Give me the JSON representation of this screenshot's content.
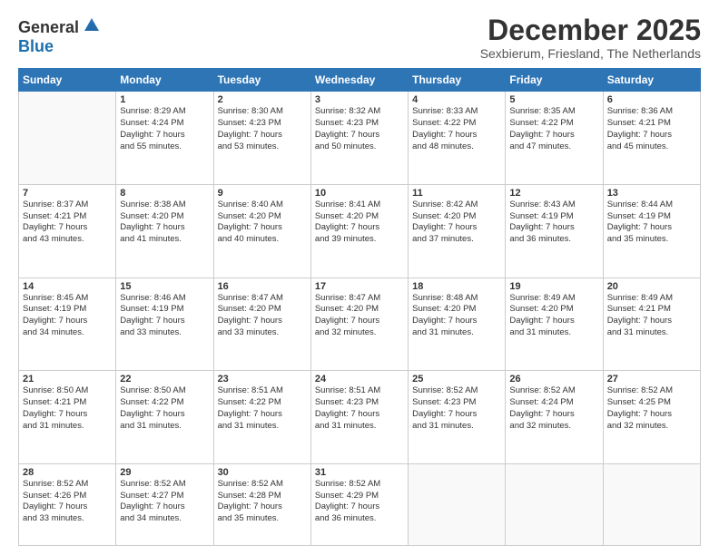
{
  "logo": {
    "general": "General",
    "blue": "Blue"
  },
  "header": {
    "month": "December 2025",
    "location": "Sexbierum, Friesland, The Netherlands"
  },
  "days_of_week": [
    "Sunday",
    "Monday",
    "Tuesday",
    "Wednesday",
    "Thursday",
    "Friday",
    "Saturday"
  ],
  "weeks": [
    [
      {
        "day": "",
        "info": ""
      },
      {
        "day": "1",
        "info": "Sunrise: 8:29 AM\nSunset: 4:24 PM\nDaylight: 7 hours\nand 55 minutes."
      },
      {
        "day": "2",
        "info": "Sunrise: 8:30 AM\nSunset: 4:23 PM\nDaylight: 7 hours\nand 53 minutes."
      },
      {
        "day": "3",
        "info": "Sunrise: 8:32 AM\nSunset: 4:23 PM\nDaylight: 7 hours\nand 50 minutes."
      },
      {
        "day": "4",
        "info": "Sunrise: 8:33 AM\nSunset: 4:22 PM\nDaylight: 7 hours\nand 48 minutes."
      },
      {
        "day": "5",
        "info": "Sunrise: 8:35 AM\nSunset: 4:22 PM\nDaylight: 7 hours\nand 47 minutes."
      },
      {
        "day": "6",
        "info": "Sunrise: 8:36 AM\nSunset: 4:21 PM\nDaylight: 7 hours\nand 45 minutes."
      }
    ],
    [
      {
        "day": "7",
        "info": "Sunrise: 8:37 AM\nSunset: 4:21 PM\nDaylight: 7 hours\nand 43 minutes."
      },
      {
        "day": "8",
        "info": "Sunrise: 8:38 AM\nSunset: 4:20 PM\nDaylight: 7 hours\nand 41 minutes."
      },
      {
        "day": "9",
        "info": "Sunrise: 8:40 AM\nSunset: 4:20 PM\nDaylight: 7 hours\nand 40 minutes."
      },
      {
        "day": "10",
        "info": "Sunrise: 8:41 AM\nSunset: 4:20 PM\nDaylight: 7 hours\nand 39 minutes."
      },
      {
        "day": "11",
        "info": "Sunrise: 8:42 AM\nSunset: 4:20 PM\nDaylight: 7 hours\nand 37 minutes."
      },
      {
        "day": "12",
        "info": "Sunrise: 8:43 AM\nSunset: 4:19 PM\nDaylight: 7 hours\nand 36 minutes."
      },
      {
        "day": "13",
        "info": "Sunrise: 8:44 AM\nSunset: 4:19 PM\nDaylight: 7 hours\nand 35 minutes."
      }
    ],
    [
      {
        "day": "14",
        "info": "Sunrise: 8:45 AM\nSunset: 4:19 PM\nDaylight: 7 hours\nand 34 minutes."
      },
      {
        "day": "15",
        "info": "Sunrise: 8:46 AM\nSunset: 4:19 PM\nDaylight: 7 hours\nand 33 minutes."
      },
      {
        "day": "16",
        "info": "Sunrise: 8:47 AM\nSunset: 4:20 PM\nDaylight: 7 hours\nand 33 minutes."
      },
      {
        "day": "17",
        "info": "Sunrise: 8:47 AM\nSunset: 4:20 PM\nDaylight: 7 hours\nand 32 minutes."
      },
      {
        "day": "18",
        "info": "Sunrise: 8:48 AM\nSunset: 4:20 PM\nDaylight: 7 hours\nand 31 minutes."
      },
      {
        "day": "19",
        "info": "Sunrise: 8:49 AM\nSunset: 4:20 PM\nDaylight: 7 hours\nand 31 minutes."
      },
      {
        "day": "20",
        "info": "Sunrise: 8:49 AM\nSunset: 4:21 PM\nDaylight: 7 hours\nand 31 minutes."
      }
    ],
    [
      {
        "day": "21",
        "info": "Sunrise: 8:50 AM\nSunset: 4:21 PM\nDaylight: 7 hours\nand 31 minutes."
      },
      {
        "day": "22",
        "info": "Sunrise: 8:50 AM\nSunset: 4:22 PM\nDaylight: 7 hours\nand 31 minutes."
      },
      {
        "day": "23",
        "info": "Sunrise: 8:51 AM\nSunset: 4:22 PM\nDaylight: 7 hours\nand 31 minutes."
      },
      {
        "day": "24",
        "info": "Sunrise: 8:51 AM\nSunset: 4:23 PM\nDaylight: 7 hours\nand 31 minutes."
      },
      {
        "day": "25",
        "info": "Sunrise: 8:52 AM\nSunset: 4:23 PM\nDaylight: 7 hours\nand 31 minutes."
      },
      {
        "day": "26",
        "info": "Sunrise: 8:52 AM\nSunset: 4:24 PM\nDaylight: 7 hours\nand 32 minutes."
      },
      {
        "day": "27",
        "info": "Sunrise: 8:52 AM\nSunset: 4:25 PM\nDaylight: 7 hours\nand 32 minutes."
      }
    ],
    [
      {
        "day": "28",
        "info": "Sunrise: 8:52 AM\nSunset: 4:26 PM\nDaylight: 7 hours\nand 33 minutes."
      },
      {
        "day": "29",
        "info": "Sunrise: 8:52 AM\nSunset: 4:27 PM\nDaylight: 7 hours\nand 34 minutes."
      },
      {
        "day": "30",
        "info": "Sunrise: 8:52 AM\nSunset: 4:28 PM\nDaylight: 7 hours\nand 35 minutes."
      },
      {
        "day": "31",
        "info": "Sunrise: 8:52 AM\nSunset: 4:29 PM\nDaylight: 7 hours\nand 36 minutes."
      },
      {
        "day": "",
        "info": ""
      },
      {
        "day": "",
        "info": ""
      },
      {
        "day": "",
        "info": ""
      }
    ]
  ]
}
